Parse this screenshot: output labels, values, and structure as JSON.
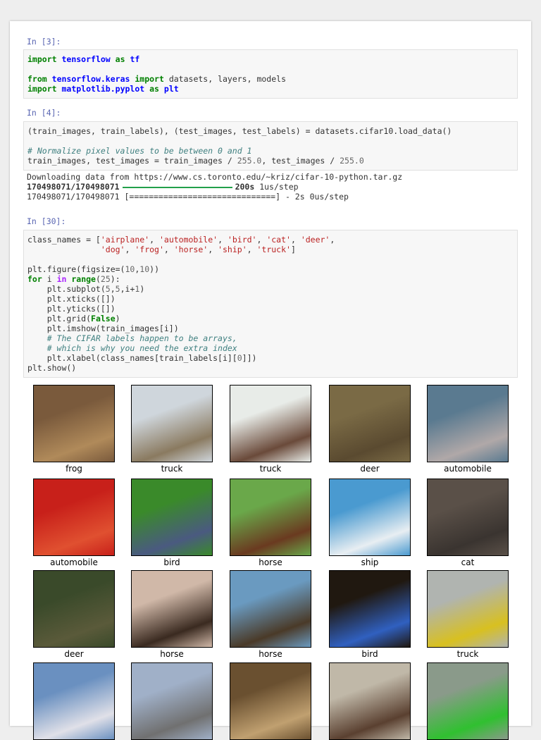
{
  "cells": [
    {
      "prompt": "In [3]:",
      "lines": [
        [
          [
            "import",
            "kw"
          ],
          [
            " "
          ],
          [
            "tensorflow",
            "nm"
          ],
          [
            " "
          ],
          [
            "as",
            "kw"
          ],
          [
            " "
          ],
          [
            "tf",
            "nm"
          ]
        ],
        [],
        [
          [
            "from",
            "kw"
          ],
          [
            " "
          ],
          [
            "tensorflow.keras",
            "nm"
          ],
          [
            " "
          ],
          [
            "import",
            "kw"
          ],
          [
            " datasets, layers, models"
          ]
        ],
        [
          [
            "import",
            "kw"
          ],
          [
            " "
          ],
          [
            "matplotlib.pyplot",
            "nm"
          ],
          [
            " "
          ],
          [
            "as",
            "kw"
          ],
          [
            " "
          ],
          [
            "plt",
            "nm"
          ]
        ]
      ]
    },
    {
      "prompt": "In [4]:",
      "lines": [
        [
          [
            "(train_images, train_labels), (test_images, test_labels) = datasets.cifar10.load_data()"
          ]
        ],
        [],
        [
          [
            "# Normalize pixel values to be between 0 and 1",
            "cm"
          ]
        ],
        [
          [
            "train_images, test_images = train_images / "
          ],
          [
            "255.0",
            "nu"
          ],
          [
            ", test_images / "
          ],
          [
            "255.0",
            "nu"
          ]
        ]
      ],
      "output": [
        [
          [
            "Downloading data from https://www.cs.toronto.edu/~kriz/cifar-10-python.tar.gz"
          ]
        ],
        [
          [
            "170498071/170498071",
            "b"
          ],
          [
            "",
            "bar"
          ],
          [
            "200s",
            "b"
          ],
          [
            " 1us/step"
          ]
        ],
        [
          [
            "170498071/170498071 [==============================] - 2s 0us/step"
          ]
        ]
      ]
    },
    {
      "prompt": "In [30]:",
      "lines": [
        [
          [
            "class_names = ["
          ],
          [
            "'airplane'",
            "st"
          ],
          [
            ", "
          ],
          [
            "'automobile'",
            "st"
          ],
          [
            ", "
          ],
          [
            "'bird'",
            "st"
          ],
          [
            ", "
          ],
          [
            "'cat'",
            "st"
          ],
          [
            ", "
          ],
          [
            "'deer'",
            "st"
          ],
          [
            ","
          ]
        ],
        [
          [
            "               "
          ],
          [
            "'dog'",
            "st"
          ],
          [
            ", "
          ],
          [
            "'frog'",
            "st"
          ],
          [
            ", "
          ],
          [
            "'horse'",
            "st"
          ],
          [
            ", "
          ],
          [
            "'ship'",
            "st"
          ],
          [
            ", "
          ],
          [
            "'truck'",
            "st"
          ],
          [
            "]"
          ]
        ],
        [],
        [
          [
            "plt.figure(figsize=("
          ],
          [
            "10",
            "nu"
          ],
          [
            ","
          ],
          [
            "10",
            "nu"
          ],
          [
            "))"
          ]
        ],
        [
          [
            "for",
            "kw"
          ],
          [
            " i "
          ],
          [
            "in",
            "op"
          ],
          [
            " "
          ],
          [
            "range",
            "kw"
          ],
          [
            "("
          ],
          [
            "25",
            "nu"
          ],
          [
            "):"
          ]
        ],
        [
          [
            "    plt.subplot("
          ],
          [
            "5",
            "nu"
          ],
          [
            ","
          ],
          [
            "5",
            "nu"
          ],
          [
            ",i+"
          ],
          [
            "1",
            "nu"
          ],
          [
            ")"
          ]
        ],
        [
          [
            "    plt.xticks([])"
          ]
        ],
        [
          [
            "    plt.yticks([])"
          ]
        ],
        [
          [
            "    plt.grid("
          ],
          [
            "False",
            "kw"
          ],
          [
            ")"
          ]
        ],
        [
          [
            "    plt.imshow(train_images[i])"
          ]
        ],
        [
          [
            "    # The CIFAR labels happen to be arrays,",
            "cm"
          ]
        ],
        [
          [
            "    # which is why you need the extra index",
            "cm"
          ]
        ],
        [
          [
            "    plt.xlabel(class_names[train_labels[i]["
          ],
          [
            "0",
            "nu"
          ],
          [
            "]])"
          ]
        ],
        [
          [
            "plt.show()"
          ]
        ]
      ]
    }
  ],
  "figure": {
    "labels": [
      "frog",
      "truck",
      "truck",
      "deer",
      "automobile",
      "automobile",
      "bird",
      "horse",
      "ship",
      "cat",
      "deer",
      "horse",
      "horse",
      "bird",
      "truck"
    ],
    "colors": [
      [
        "#7a5a3c",
        "#b08a5a"
      ],
      [
        "#cfd6dc",
        "#8a7a60"
      ],
      [
        "#e8ece8",
        "#6a4a3a"
      ],
      [
        "#7a6a45",
        "#5a4a30"
      ],
      [
        "#5a7a90",
        "#b0a8a8"
      ],
      [
        "#c8201a",
        "#e05030"
      ],
      [
        "#3a8a2a",
        "#4a5a80"
      ],
      [
        "#6aa84a",
        "#6a3a20"
      ],
      [
        "#4a9ad0",
        "#e8eef2"
      ],
      [
        "#5a5048",
        "#3a3430"
      ],
      [
        "#3a4a2a",
        "#5a5a3a"
      ],
      [
        "#d0b8a8",
        "#3a2a20"
      ],
      [
        "#6a9ac0",
        "#4a3a28"
      ],
      [
        "#201810",
        "#3060c0"
      ],
      [
        "#b0b4b0",
        "#d8c020"
      ],
      [
        "#6a90c0",
        "#e0e0e8"
      ],
      [
        "#a0b0c8",
        "#707070"
      ],
      [
        "#6a5030",
        "#c0a070"
      ],
      [
        "#c0b8a8",
        "#5a4030"
      ],
      [
        "#8a9a8a",
        "#30c030"
      ]
    ]
  }
}
